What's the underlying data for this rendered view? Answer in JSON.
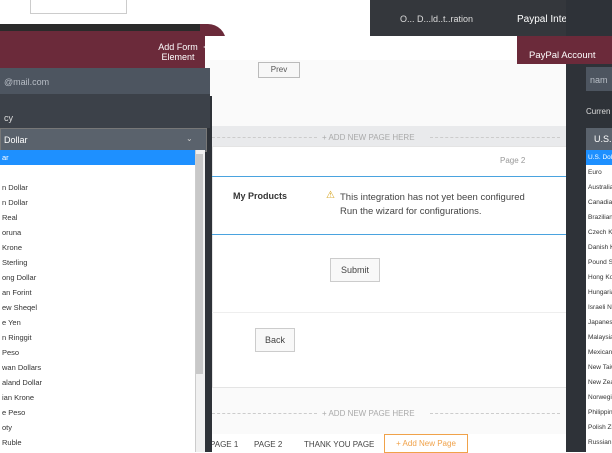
{
  "top": {
    "right_caption": "O... D...ld..t..ration",
    "right_title": "Paypal Integration",
    "right_icon": "✕"
  },
  "form_builder": {
    "add_form_element": "Add Form Element",
    "add_icon": "+",
    "prev_label": "Prev"
  },
  "editor": {
    "add_new_page": "+ ADD NEW PAGE HERE",
    "page_label": "Page 2",
    "product_label": "My Products",
    "warning_icon": "⚠",
    "warning_line1": "This integration has not yet been configured",
    "warning_line2": "Run the wizard for configurations.",
    "submit_label": "Submit",
    "back_label": "Back",
    "tabs": [
      "PAGE 1",
      "PAGE 2",
      "THANK YOU PAGE"
    ],
    "add_page_tab": "+ Add New Page"
  },
  "left_dropdown": {
    "email_placeholder": "@mail.com",
    "currency_label": "cy",
    "selected": "Dollar",
    "arrow": "⌄",
    "items": [
      "ar",
      "",
      "n Dollar",
      "n Dollar",
      "Real",
      "oruna",
      "Krone",
      "Sterling",
      "ong Dollar",
      "an Forint",
      "ew Sheqel",
      "e Yen",
      "n Ringgit",
      "Peso",
      "wan Dollars",
      "aland Dollar",
      "ian Krone",
      "e Peso",
      "oty",
      "Ruble"
    ],
    "selected_index": 0
  },
  "right_panel": {
    "paypal_account": "PayPal Account",
    "input_placeholder": "nam",
    "currency_label": "Curren",
    "selected": "U.S.",
    "items": [
      "U.S. Dollar",
      "Euro",
      "Australian Dollar",
      "Canadian Dollar",
      "Brazilian Real",
      "Czech Koruna",
      "Danish Krone",
      "Pound Sterling",
      "Hong Kong Dollar",
      "Hungarian Forint",
      "Israeli New Sheqel",
      "Japanese Yen",
      "Malaysian Ringgit",
      "Mexican Peso",
      "New Taiwan Dollars",
      "New Zealand Dollar",
      "Norwegian Krone",
      "Philippine Peso",
      "Polish Zloty",
      "Russian Ruble"
    ],
    "selected_index": 0
  }
}
